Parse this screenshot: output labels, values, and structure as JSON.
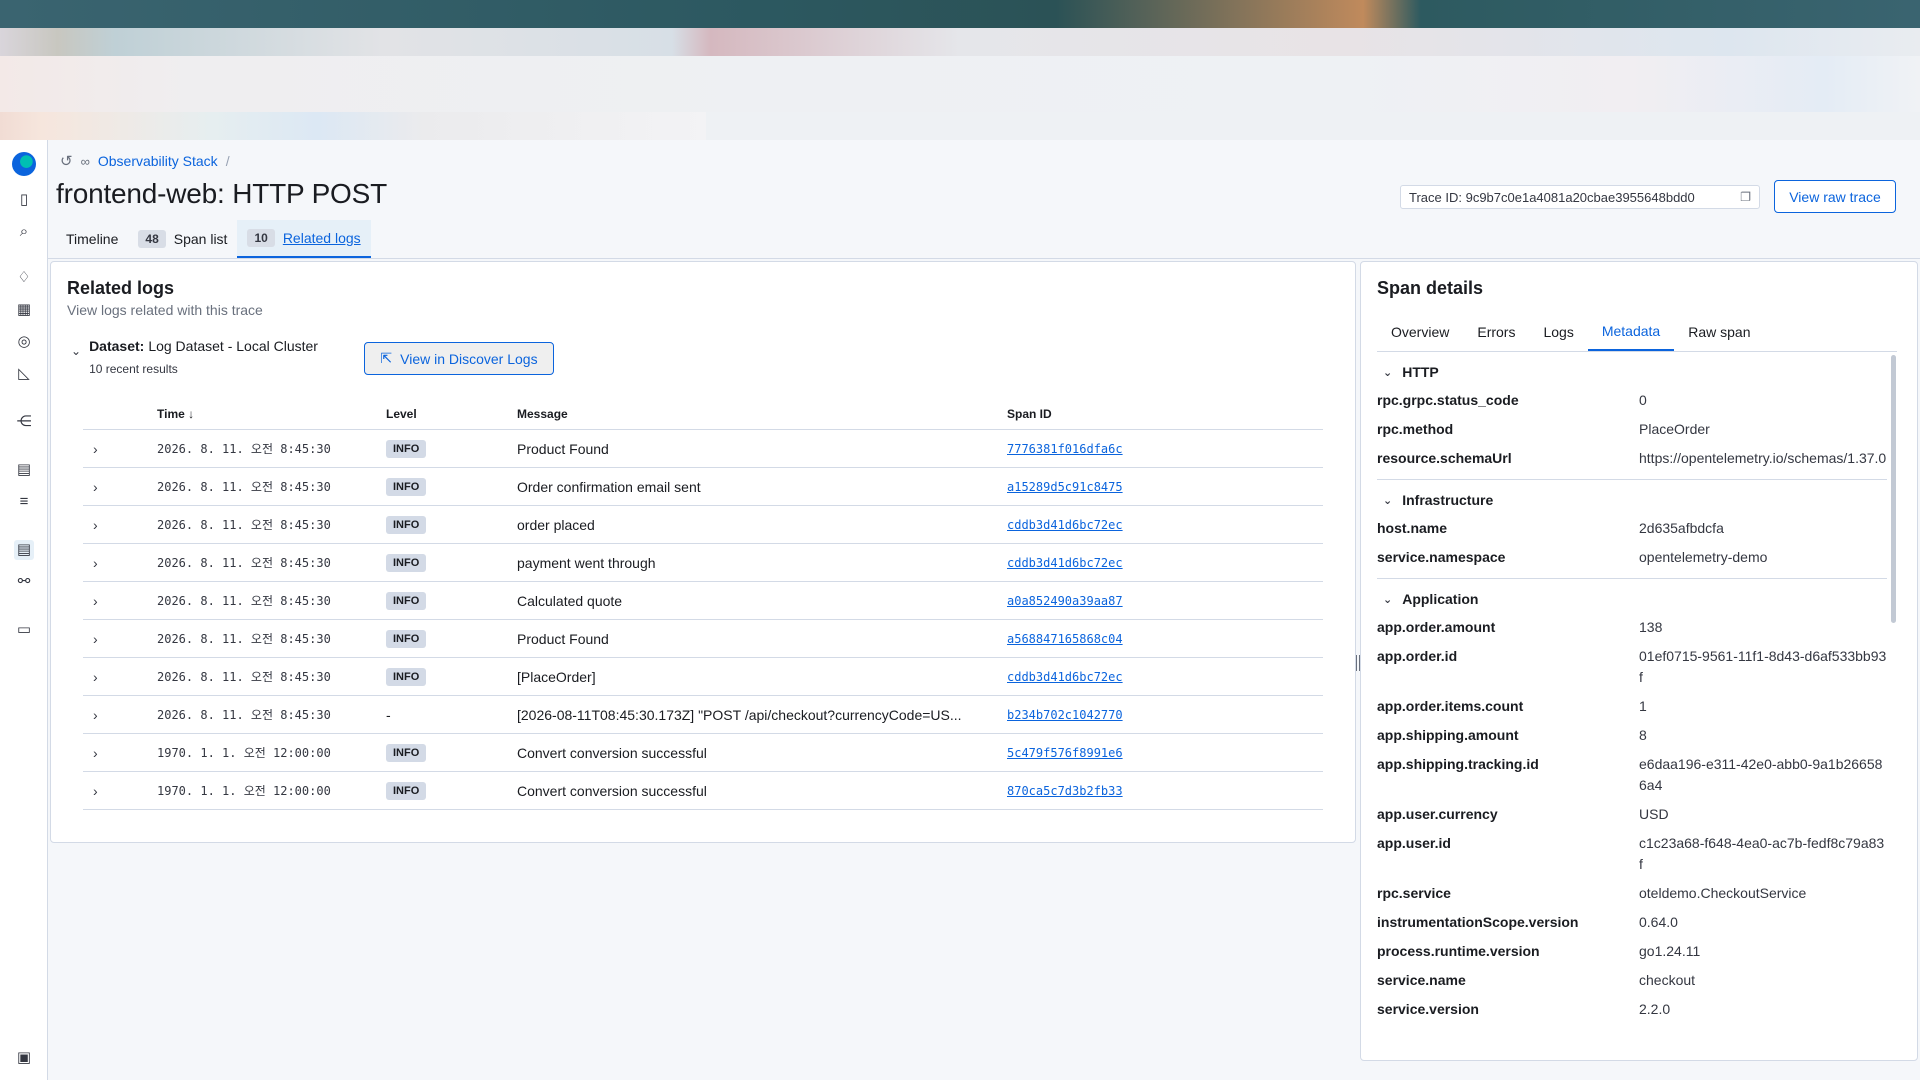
{
  "breadcrumb": {
    "link": "Observability Stack",
    "sep": "/"
  },
  "page_title": "frontend-web: HTTP POST",
  "trace_id": "Trace ID: 9c9b7c0e1a4081a20cbae3955648bdd0",
  "view_raw_trace": "View raw trace",
  "tabs": [
    {
      "count": "",
      "label": "Timeline"
    },
    {
      "count": "48",
      "label": "Span list"
    },
    {
      "count": "10",
      "label": "Related logs"
    }
  ],
  "logs": {
    "title": "Related logs",
    "subtitle": "View logs related with this trace",
    "dataset_label": "Dataset:",
    "dataset_value": "Log Dataset - Local Cluster",
    "results": "10 recent results",
    "discover_button": "View in Discover Logs",
    "columns": {
      "time": "Time",
      "level": "Level",
      "message": "Message",
      "span": "Span ID"
    },
    "rows": [
      {
        "time": "2026. 8. 11. 오전 8:45:30",
        "level": "INFO",
        "message": "Product Found",
        "span": "7776381f016dfa6c"
      },
      {
        "time": "2026. 8. 11. 오전 8:45:30",
        "level": "INFO",
        "message": "Order confirmation email sent",
        "span": "a15289d5c91c8475"
      },
      {
        "time": "2026. 8. 11. 오전 8:45:30",
        "level": "INFO",
        "message": "order placed",
        "span": "cddb3d41d6bc72ec"
      },
      {
        "time": "2026. 8. 11. 오전 8:45:30",
        "level": "INFO",
        "message": "payment went through",
        "span": "cddb3d41d6bc72ec"
      },
      {
        "time": "2026. 8. 11. 오전 8:45:30",
        "level": "INFO",
        "message": "Calculated quote",
        "span": "a0a852490a39aa87"
      },
      {
        "time": "2026. 8. 11. 오전 8:45:30",
        "level": "INFO",
        "message": "Product Found",
        "span": "a568847165868c04"
      },
      {
        "time": "2026. 8. 11. 오전 8:45:30",
        "level": "INFO",
        "message": "[PlaceOrder]",
        "span": "cddb3d41d6bc72ec"
      },
      {
        "time": "2026. 8. 11. 오전 8:45:30",
        "level": "-",
        "message": "[2026-08-11T08:45:30.173Z] \"POST /api/checkout?currencyCode=US...",
        "span": "b234b702c1042770"
      },
      {
        "time": "1970. 1. 1. 오전 12:00:00",
        "level": "INFO",
        "message": "Convert conversion successful",
        "span": "5c479f576f8991e6"
      },
      {
        "time": "1970. 1. 1. 오전 12:00:00",
        "level": "INFO",
        "message": "Convert conversion successful",
        "span": "870ca5c7d3b2fb33"
      }
    ]
  },
  "details": {
    "title": "Span details",
    "tabs": [
      "Overview",
      "Errors",
      "Logs",
      "Metadata",
      "Raw span"
    ],
    "sections": {
      "http": "HTTP",
      "infra": "Infrastructure",
      "app": "Application"
    },
    "http": [
      {
        "k": "rpc.grpc.status_code",
        "v": "0"
      },
      {
        "k": "rpc.method",
        "v": "PlaceOrder"
      },
      {
        "k": "resource.schemaUrl",
        "v": "https://opentelemetry.io/schemas/1.37.0"
      }
    ],
    "infra": [
      {
        "k": "host.name",
        "v": "2d635afbdcfa"
      },
      {
        "k": "service.namespace",
        "v": "opentelemetry-demo"
      }
    ],
    "app": [
      {
        "k": "app.order.amount",
        "v": "138"
      },
      {
        "k": "app.order.id",
        "v": "01ef0715-9561-11f1-8d43-d6af533bb93f"
      },
      {
        "k": "app.order.items.count",
        "v": "1"
      },
      {
        "k": "app.shipping.amount",
        "v": "8"
      },
      {
        "k": "app.shipping.tracking.id",
        "v": "e6daa196-e311-42e0-abb0-9a1b266586a4"
      },
      {
        "k": "app.user.currency",
        "v": "USD"
      },
      {
        "k": "app.user.id",
        "v": "c1c23a68-f648-4ea0-ac7b-fedf8c79a83f"
      },
      {
        "k": "rpc.service",
        "v": "oteldemo.CheckoutService"
      },
      {
        "k": "instrumentationScope.version",
        "v": "0.64.0"
      },
      {
        "k": "process.runtime.version",
        "v": "go1.24.11"
      },
      {
        "k": "service.name",
        "v": "checkout"
      },
      {
        "k": "service.version",
        "v": "2.2.0"
      }
    ]
  },
  "icons": {
    "history": "history-icon",
    "binoculars": "binoculars-icon",
    "copy": "copy-icon",
    "external": "external-link-icon",
    "expand": "chevron-right-icon",
    "collapse": "chevron-down-icon"
  },
  "colors": {
    "accent": "#0b64dd",
    "border": "#d3dae6",
    "badge": "#d3dae6"
  }
}
